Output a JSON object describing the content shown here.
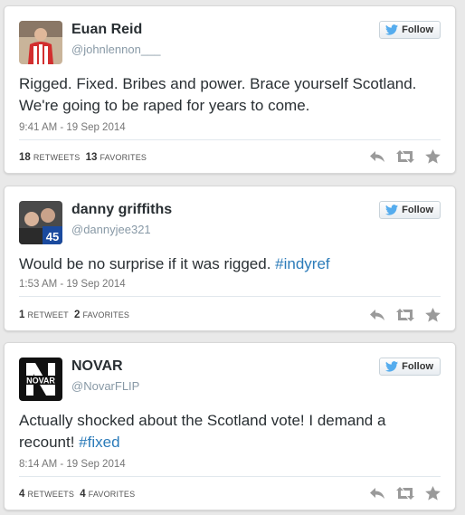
{
  "colors": {
    "link": "#2b7bb9",
    "twitter_bird": "#55acee",
    "icon_gray": "#9a9a9a"
  },
  "tweets": [
    {
      "name": "Euan Reid",
      "handle": "@johnlennon___",
      "follow_label": "Follow",
      "text_parts": [
        "Rigged. Fixed. Bribes and power. Brace yourself Scotland. We're going to be raped for years to come."
      ],
      "hashtag": "",
      "timestamp": "9:41 AM - 19 Sep 2014",
      "retweets_count": "18",
      "retweets_label": "RETWEETS",
      "favorites_count": "13",
      "favorites_label": "FAVORITES"
    },
    {
      "name": "danny griffiths",
      "handle": "@dannyjee321",
      "follow_label": "Follow",
      "text_parts": [
        "Would be no surprise if it was rigged. "
      ],
      "hashtag": "#indyref",
      "avatar_badge": "45",
      "timestamp": "1:53 AM - 19 Sep 2014",
      "retweets_count": "1",
      "retweets_label": "RETWEET",
      "favorites_count": "2",
      "favorites_label": "FAVORITES"
    },
    {
      "name": "NOVAR",
      "handle": "@NovarFLIP",
      "follow_label": "Follow",
      "text_parts": [
        "Actually shocked about the Scotland vote! I demand a recount! "
      ],
      "hashtag": "#fixed",
      "avatar_text": "NOVAR",
      "timestamp": "8:14 AM - 19 Sep 2014",
      "retweets_count": "4",
      "retweets_label": "RETWEETS",
      "favorites_count": "4",
      "favorites_label": "FAVORITES"
    }
  ]
}
